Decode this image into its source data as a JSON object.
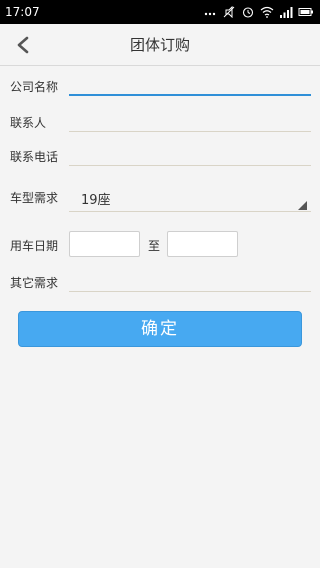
{
  "status_bar": {
    "time": "17:07",
    "icons": [
      "more-dots-icon",
      "mute-icon",
      "alarm-icon",
      "wifi-icon",
      "signal-icon",
      "battery-icon"
    ]
  },
  "header": {
    "back_icon": "chevron-left-icon",
    "title": "团体订购"
  },
  "form": {
    "company_label": "公司名称",
    "company_value": "",
    "contact_label": "联系人",
    "contact_value": "",
    "phone_label": "联系电话",
    "phone_value": "",
    "vehicle_label": "车型需求",
    "vehicle_selected": "19座",
    "date_label": "用车日期",
    "date_from": "",
    "date_separator": "至",
    "date_to": "",
    "other_label": "其它需求",
    "other_value": ""
  },
  "actions": {
    "confirm_label": "确定"
  },
  "colors": {
    "accent": "#47a9f1",
    "focus_line": "#2f8fd8",
    "background": "#f4f4f4"
  }
}
